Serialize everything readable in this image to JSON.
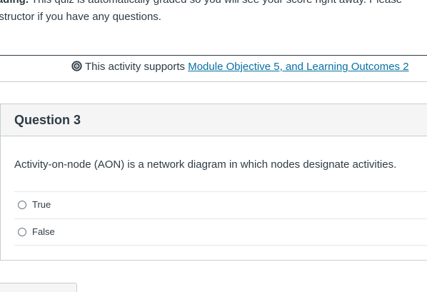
{
  "intro": {
    "bold_label": "rading.",
    "line1_rest": " This quiz is automatically graded so you will see your score right away. Please",
    "line2": "nstructor if you have any questions."
  },
  "objective": {
    "icon": "target-icon",
    "prefix": "This activity supports ",
    "link": "Module Objective 5, and Learning Outcomes 2"
  },
  "question": {
    "title": "Question 3",
    "text": "Activity-on-node (AON) is a network diagram in which nodes designate activities.",
    "answers": [
      {
        "label": "True",
        "selected": false
      },
      {
        "label": "False",
        "selected": false
      }
    ]
  },
  "colors": {
    "text": "#2d3b45",
    "link": "#0770a3",
    "border": "#c7cdd1",
    "header_bg": "#f5f5f5"
  }
}
